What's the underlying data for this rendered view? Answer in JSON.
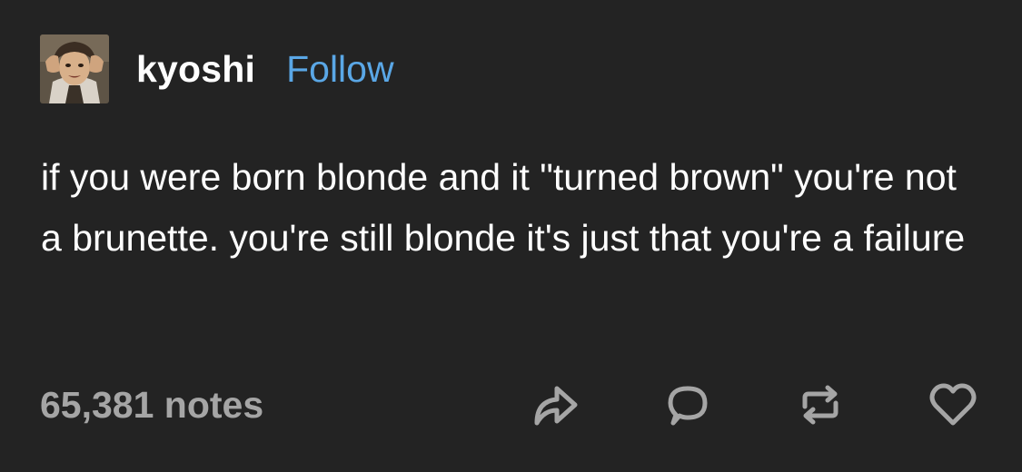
{
  "post": {
    "author": {
      "username": "kyoshi",
      "follow_label": "Follow",
      "avatar_icon": "avatar-anime-character"
    },
    "body": "if you were born blonde and it \"turned brown\" you're not a brunette. you're still blonde it's just that you're a failure",
    "footer": {
      "notes": "65,381 notes",
      "actions": [
        "share-icon",
        "comment-icon",
        "reblog-icon",
        "like-icon"
      ]
    }
  },
  "colors": {
    "background": "#232323",
    "text": "#ffffff",
    "follow_accent": "#5aa7e6",
    "muted": "#a5a5a5"
  }
}
